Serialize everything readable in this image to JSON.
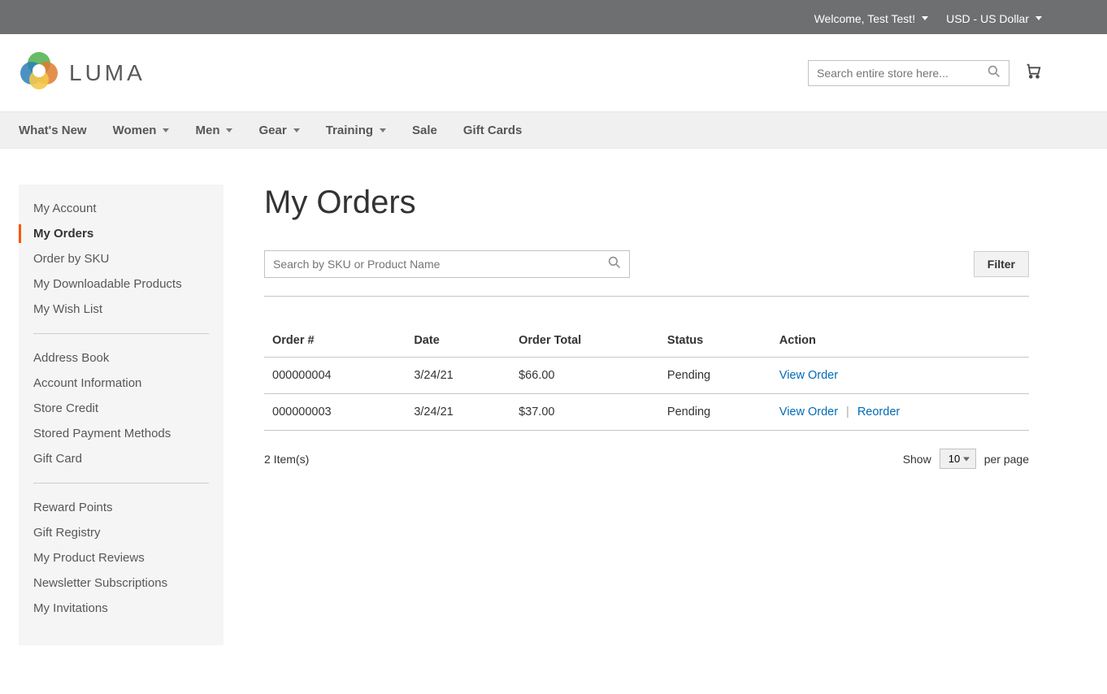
{
  "topbar": {
    "welcome": "Welcome, Test Test!",
    "currency": "USD - US Dollar"
  },
  "header": {
    "brand": "LUMA",
    "search_placeholder": "Search entire store here..."
  },
  "nav": {
    "items": [
      {
        "label": "What's New",
        "dropdown": false
      },
      {
        "label": "Women",
        "dropdown": true
      },
      {
        "label": "Men",
        "dropdown": true
      },
      {
        "label": "Gear",
        "dropdown": true
      },
      {
        "label": "Training",
        "dropdown": true
      },
      {
        "label": "Sale",
        "dropdown": false
      },
      {
        "label": "Gift Cards",
        "dropdown": false
      }
    ]
  },
  "sidebar": {
    "groups": [
      [
        "My Account",
        "My Orders",
        "Order by SKU",
        "My Downloadable Products",
        "My Wish List"
      ],
      [
        "Address Book",
        "Account Information",
        "Store Credit",
        "Stored Payment Methods",
        "Gift Card"
      ],
      [
        "Reward Points",
        "Gift Registry",
        "My Product Reviews",
        "Newsletter Subscriptions",
        "My Invitations"
      ]
    ],
    "active": "My Orders"
  },
  "main": {
    "title": "My Orders",
    "sku_search_placeholder": "Search by SKU or Product Name",
    "filter_label": "Filter",
    "columns": [
      "Order #",
      "Date",
      "Order Total",
      "Status",
      "Action"
    ],
    "rows": [
      {
        "order": "000000004",
        "date": "3/24/21",
        "total": "$66.00",
        "status": "Pending",
        "actions": [
          "View Order"
        ]
      },
      {
        "order": "000000003",
        "date": "3/24/21",
        "total": "$37.00",
        "status": "Pending",
        "actions": [
          "View Order",
          "Reorder"
        ]
      }
    ],
    "summary": "2 Item(s)",
    "pager": {
      "show_label": "Show",
      "per_page": "10",
      "per_page_suffix": "per page"
    }
  }
}
